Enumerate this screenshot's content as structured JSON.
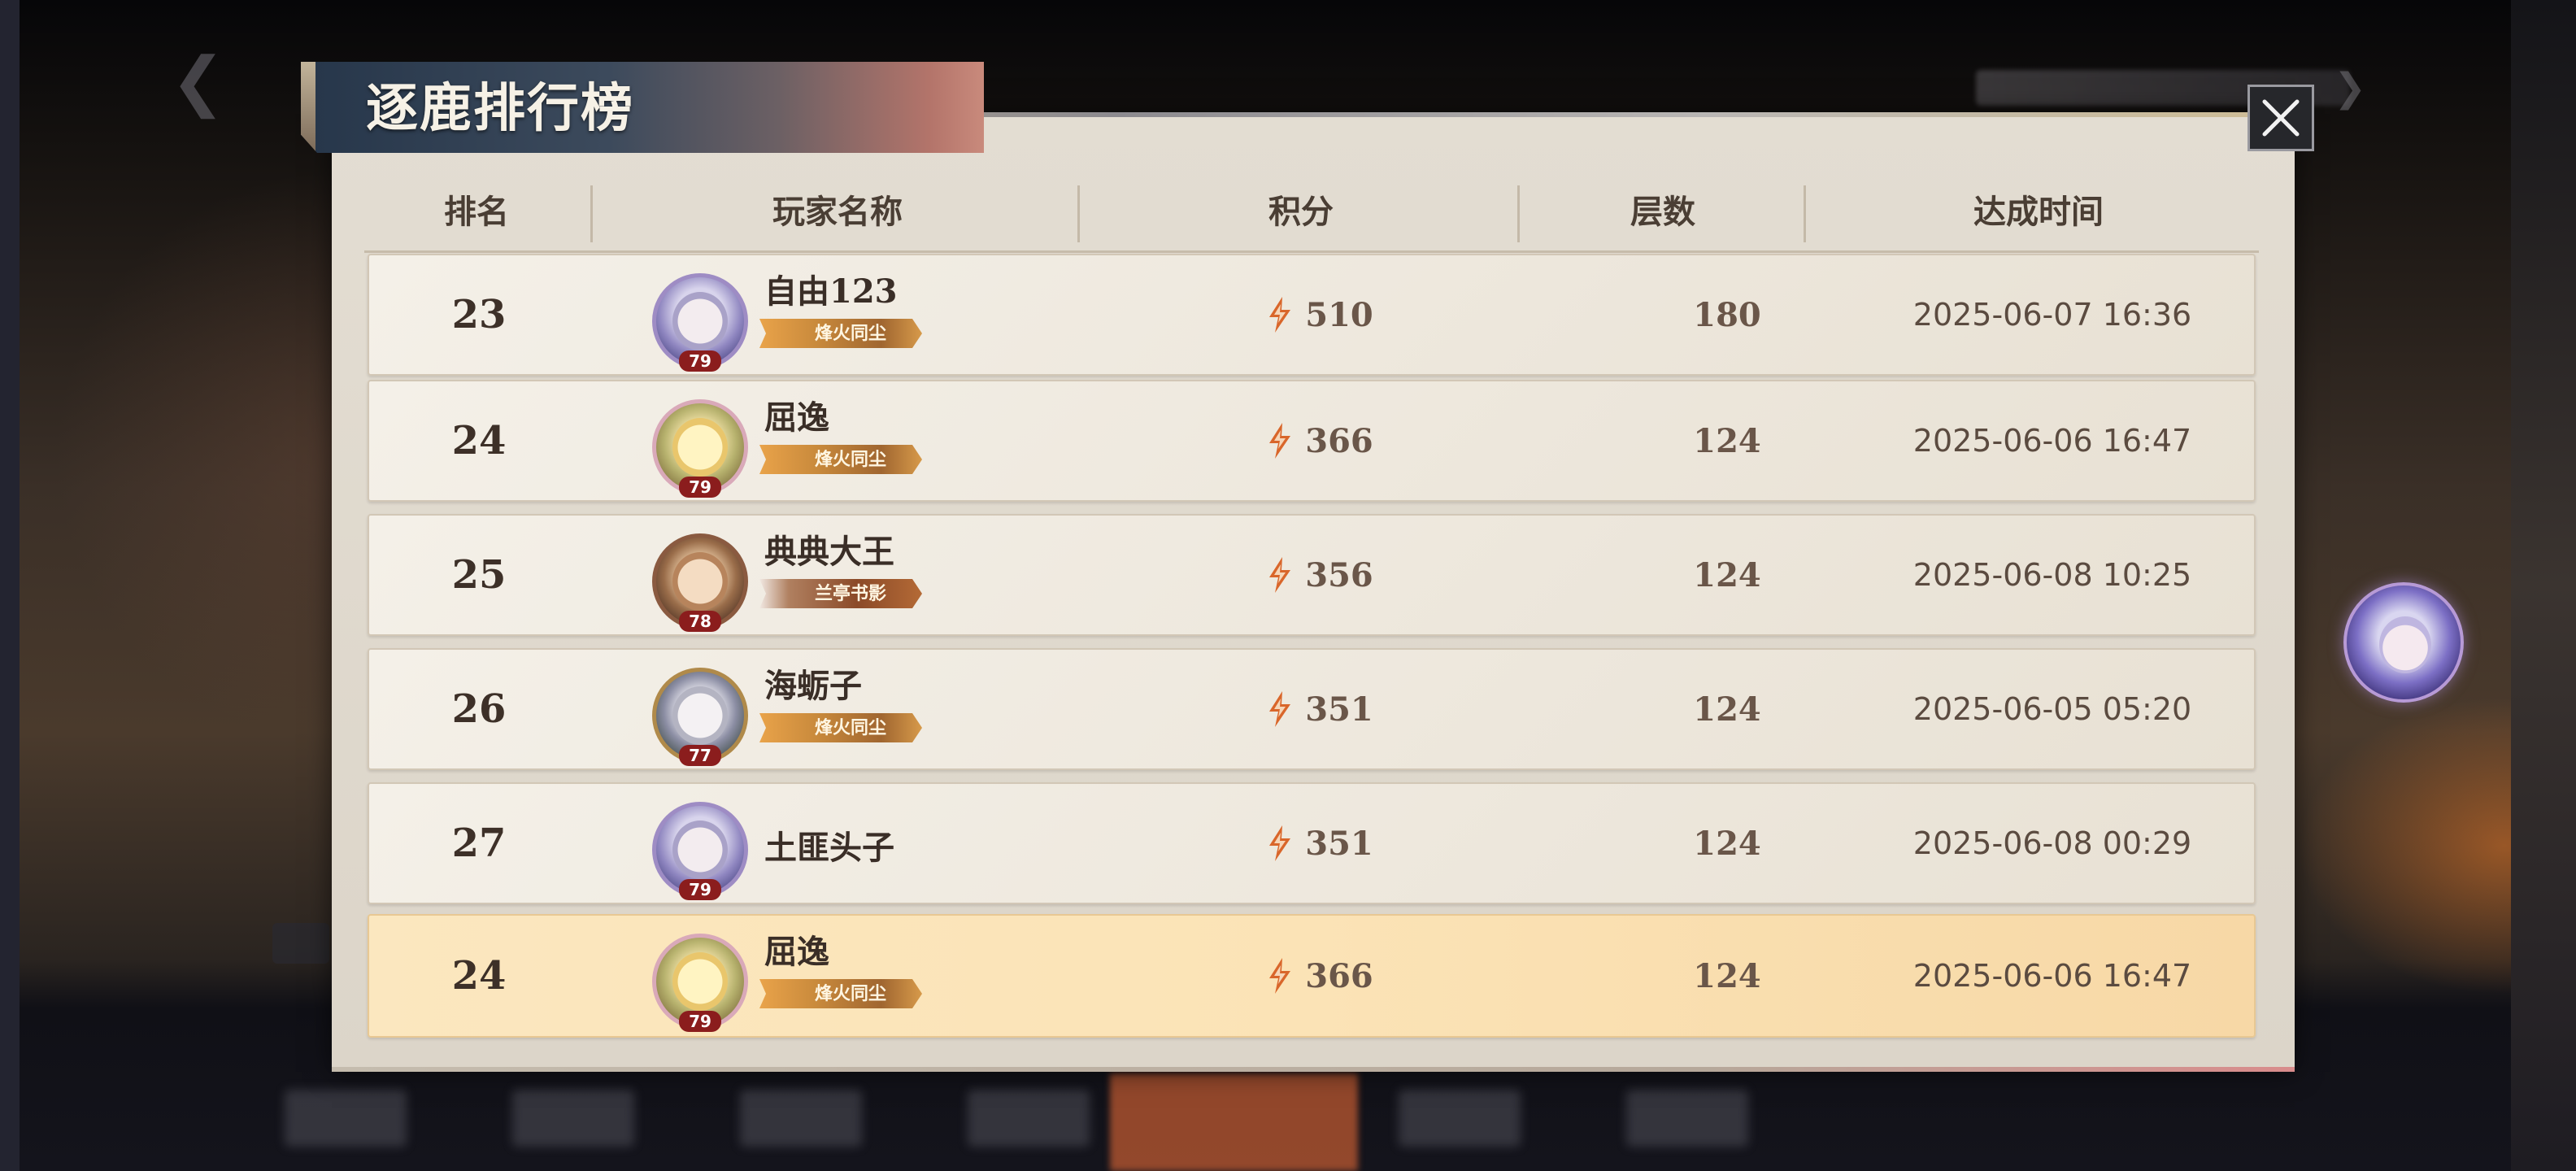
{
  "title": "逐鹿排行榜",
  "columns": {
    "rank": "排名",
    "player_name": "玩家名称",
    "score": "积分",
    "layers": "层数",
    "time": "达成时间"
  },
  "rows": [
    {
      "rank": "23",
      "name": "自由123",
      "level": "79",
      "badge": "烽火同尘",
      "score": "510",
      "layers": "180",
      "time": "2025-06-07 16:36",
      "avatar": "lavender"
    },
    {
      "rank": "24",
      "name": "屈逸",
      "level": "79",
      "badge": "烽火同尘",
      "score": "366",
      "layers": "124",
      "time": "2025-06-06 16:47",
      "avatar": "chick"
    },
    {
      "rank": "25",
      "name": "典典大王",
      "level": "78",
      "badge": "兰亭书影",
      "score": "356",
      "layers": "124",
      "time": "2025-06-08 10:25",
      "avatar": "brown"
    },
    {
      "rank": "26",
      "name": "海蛎子",
      "level": "77",
      "badge": "烽火同尘",
      "score": "351",
      "layers": "124",
      "time": "2025-06-05 05:20",
      "avatar": "silver"
    },
    {
      "rank": "27",
      "name": "土匪头子",
      "level": "79",
      "badge": "",
      "score": "351",
      "layers": "124",
      "time": "2025-06-08 00:29",
      "avatar": "lavender"
    }
  ],
  "self_row": {
    "rank": "24",
    "name": "屈逸",
    "level": "79",
    "badge": "烽火同尘",
    "score": "366",
    "layers": "124",
    "time": "2025-06-06 16:47",
    "avatar": "chick"
  },
  "colors": {
    "panel": "#e0d9cd",
    "row": "#efe9df",
    "self_row": "#fbe3b6",
    "accent_score": "#d9662a",
    "level_tag": "#8b1d1d"
  },
  "icons": {
    "close": "close-icon",
    "score": "score-flame-icon"
  }
}
